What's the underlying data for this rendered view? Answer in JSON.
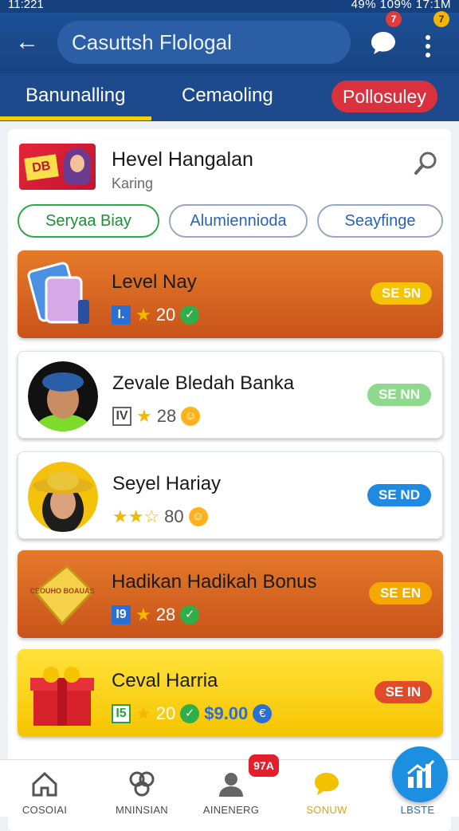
{
  "status_bar": {
    "time": "11:221",
    "right": "49%   109%  17:1M"
  },
  "app_bar": {
    "search_value": "Casuttsh Flologal",
    "chat_badge": "7",
    "menu_badge": "7"
  },
  "tabs": [
    {
      "label": "Banunalling",
      "active": true
    },
    {
      "label": "Cemaoling"
    },
    {
      "label": "Pollosuley"
    }
  ],
  "header": {
    "title": "Hevel Hangalan",
    "subtitle": "Karing",
    "image_label": "DB"
  },
  "filters": [
    "Seryaa Biay",
    "Alumiennioda",
    "Seayfinge"
  ],
  "cards": [
    {
      "name": "Level Nay",
      "level": "I.",
      "points": "20",
      "action": "SE 5N",
      "style": "orange",
      "coin_icon": "check-coin"
    },
    {
      "name": "Zevale Bledah Banka",
      "level": "IV",
      "points": "28",
      "action": "SE NN",
      "style": "white",
      "coin_icon": "smile-coin"
    },
    {
      "name": "Seyel Hariay",
      "level": "",
      "points": "80",
      "action": "SE ND",
      "style": "white",
      "coin_icon": "smile-coin"
    },
    {
      "name": "Hadikan Hadikah Bonus",
      "level": "I9",
      "points": "28",
      "action": "SE EN",
      "style": "orange",
      "coin_icon": "check-coin",
      "image_label": "CEOUHO BOAUAS"
    },
    {
      "name": "Ceval Harria",
      "level": "I5",
      "points": "20",
      "money": "$9.00",
      "action": "SE IN",
      "style": "yellow",
      "coin_icon": "check-coin"
    }
  ],
  "bottom_nav": {
    "items": [
      "COSOIAI",
      "MNINSIAN",
      "AINENERG",
      "SONUW",
      "LBSTE"
    ],
    "notif_badge": "97A"
  },
  "colors": {
    "primary": "#1d4f95",
    "accent_red": "#d9323e",
    "accent_yellow": "#f5d000"
  }
}
